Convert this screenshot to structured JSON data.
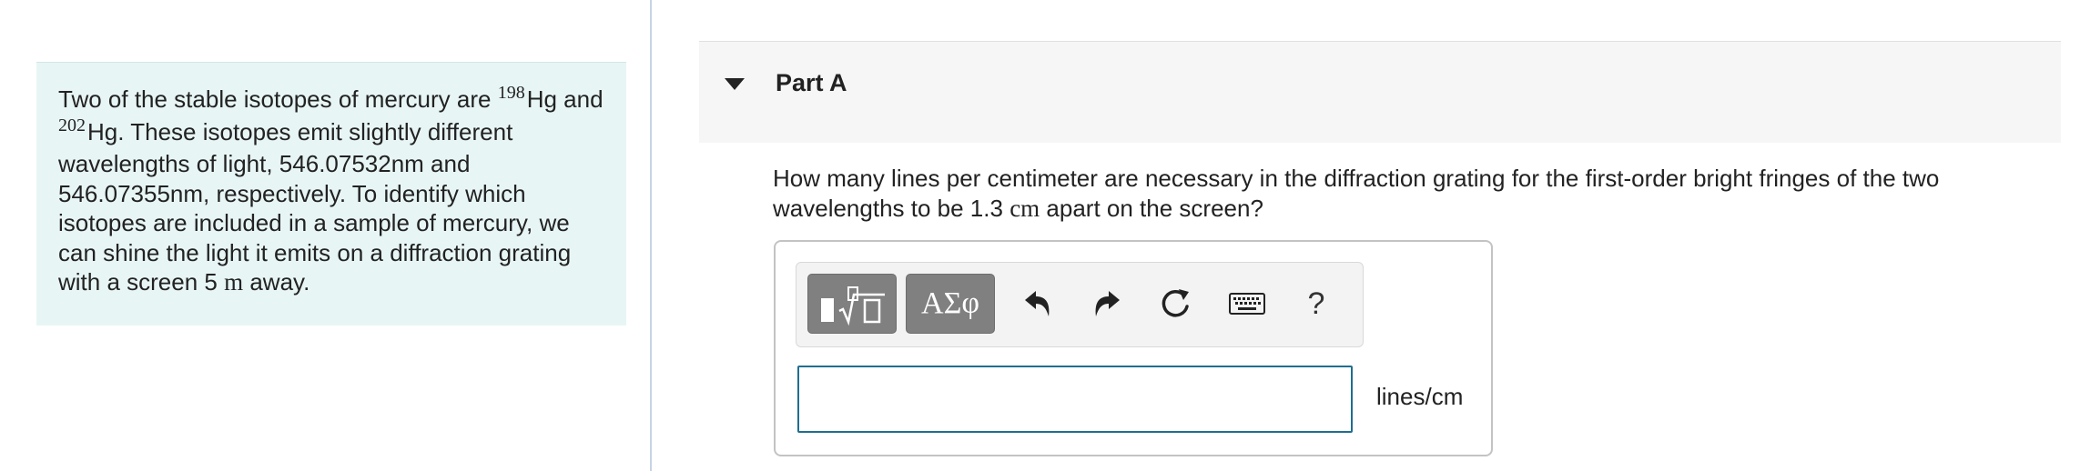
{
  "problem": {
    "sentence1_pre": "Two of the stable isotopes of mercury are ",
    "iso1_mass": "198",
    "iso1_symbol": "Hg",
    "sentence1_mid": " and ",
    "iso2_mass": "202",
    "iso2_symbol": "Hg",
    "sentence2": ".  These isotopes emit slightly different wavelengths of light, 546.07532nm and 546.07355nm, respectively.  To identify which isotopes are included in a sample of mercury, we can shine the light it emits on a diffraction grating with a screen 5 ",
    "distance_unit": "m",
    "sentence2_end": " away."
  },
  "part": {
    "title": "Part A",
    "question_pre": "How many lines per centimeter are necessary in the diffraction grating for the first-order bright fringes of the two wavelengths to be 1.3 ",
    "question_unit": "cm",
    "question_post": "  apart on the screen?"
  },
  "toolbar": {
    "symbols_label": "ΑΣφ",
    "help_label": "?"
  },
  "answer": {
    "value": "",
    "placeholder": "",
    "unit": "lines/cm"
  }
}
